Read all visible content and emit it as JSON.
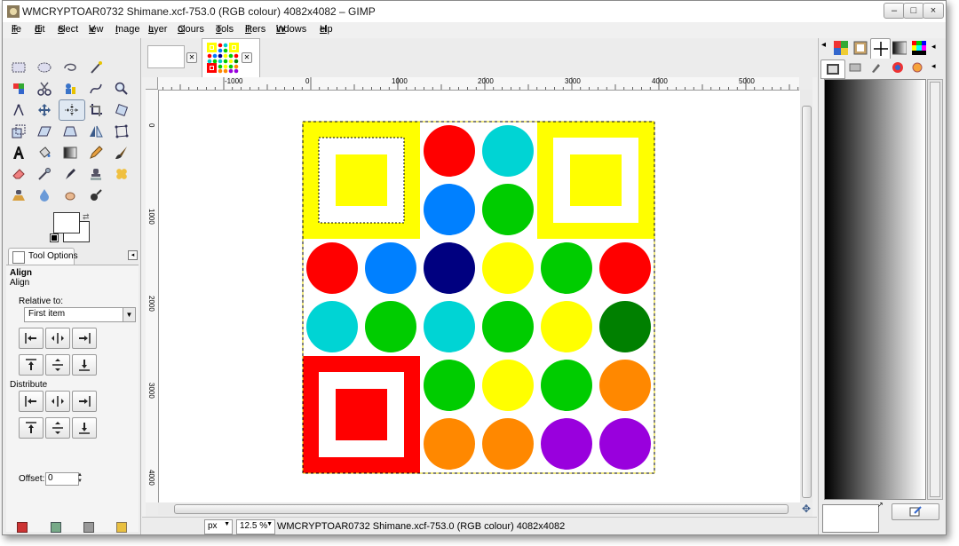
{
  "window": {
    "title": "WMCRYPTOAR0732 Shimane.xcf-753.0 (RGB colour) 4082x4082 – GIMP",
    "controls": [
      "–",
      "□",
      "×"
    ]
  },
  "menu": [
    {
      "label": "File",
      "u": "F",
      "rest": "ile"
    },
    {
      "label": "Edit",
      "u": "E",
      "rest": "dit"
    },
    {
      "label": "Select",
      "u": "S",
      "rest": "elect"
    },
    {
      "label": "View",
      "u": "V",
      "rest": "iew"
    },
    {
      "label": "Image",
      "u": "I",
      "rest": "mage"
    },
    {
      "label": "Layer",
      "u": "L",
      "rest": "ayer"
    },
    {
      "label": "Colours",
      "u": "C",
      "rest": "olours"
    },
    {
      "label": "Tools",
      "u": "T",
      "rest": "ools"
    },
    {
      "label": "Filters",
      "u": "F",
      "rest": "ilters"
    },
    {
      "label": "Windows",
      "u": "W",
      "rest": "indows"
    },
    {
      "label": "Help",
      "u": "H",
      "rest": "elp"
    }
  ],
  "tool_options": {
    "tab_label": "Tool Options",
    "heading": "Align",
    "subheading": "Align",
    "relative_to_label": "Relative to:",
    "relative_to_value": "First item",
    "distribute_label": "Distribute",
    "offset_label": "Offset:",
    "offset_value": "0"
  },
  "rulers": {
    "h_ticks": [
      "-1000",
      "0",
      "1000",
      "2000",
      "3000",
      "4000",
      "5000"
    ],
    "v_ticks": [
      "0",
      "1000",
      "2000",
      "3000",
      "4000"
    ]
  },
  "status": {
    "unit": "px",
    "zoom": "12.5 %",
    "message": "WMCRYPTOAR0732 Shimane.xcf-753.0 (RGB colour) 4082x4082"
  },
  "colors": {
    "red": "#ff0000",
    "blue": "#0080ff",
    "navy": "#000080",
    "yellow": "#ffff00",
    "green": "#00cc00",
    "darkgreen": "#008000",
    "cyan": "#00d4d4",
    "orange": "#ff8800",
    "purple": "#9900dd"
  },
  "canvas_grid": [
    [
      "square-yellow-selected",
      "square-yellow-selected",
      "red",
      "cyan",
      "square-yellow",
      "square-yellow"
    ],
    [
      "square-yellow-selected",
      "square-yellow-selected",
      "blue",
      "green",
      "square-yellow",
      "square-yellow"
    ],
    [
      "red",
      "blue",
      "navy",
      "yellow",
      "green",
      "red"
    ],
    [
      "cyan",
      "green",
      "cyan",
      "green",
      "yellow",
      "darkgreen"
    ],
    [
      "square-red",
      "square-red",
      "green",
      "yellow",
      "green",
      "orange"
    ],
    [
      "square-red",
      "square-red",
      "orange",
      "orange",
      "purple",
      "purple"
    ]
  ]
}
